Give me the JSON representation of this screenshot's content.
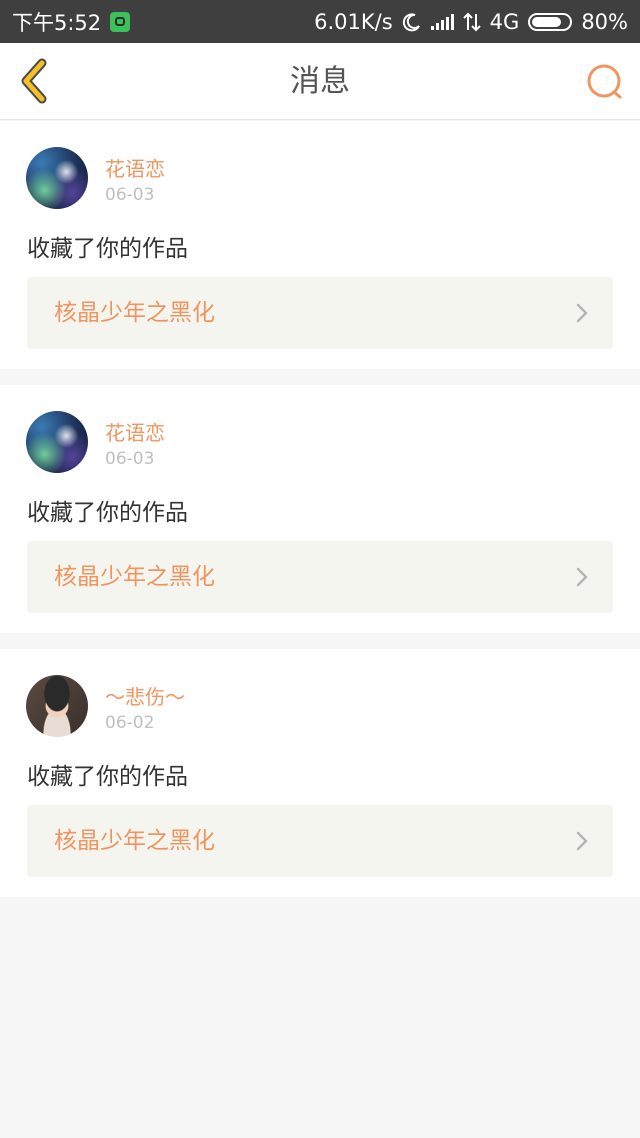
{
  "status_bar": {
    "time": "下午5:52",
    "speed": "6.01K/s",
    "network": "4G",
    "battery": "80%",
    "battery_level": 0.8
  },
  "header": {
    "title": "消息",
    "back_icon": "chevron-left-icon",
    "search_icon": "search-icon"
  },
  "colors": {
    "accent": "#f0955f",
    "back_icon": "#f3c026",
    "status_bar_bg": "#3f3f3f",
    "page_bg": "#f7f6f6",
    "work_box_bg": "#f5f5f0"
  },
  "messages": [
    {
      "username": "花语恋",
      "date": "06-03",
      "action": "收藏了你的作品",
      "work_title": "核晶少年之黑化",
      "avatar": "galaxy-avatar"
    },
    {
      "username": "花语恋",
      "date": "06-03",
      "action": "收藏了你的作品",
      "work_title": "核晶少年之黑化",
      "avatar": "galaxy-avatar"
    },
    {
      "username": "～悲伤～",
      "date": "06-02",
      "action": "收藏了你的作品",
      "work_title": "核晶少年之黑化",
      "avatar": "child-photo-avatar"
    }
  ]
}
